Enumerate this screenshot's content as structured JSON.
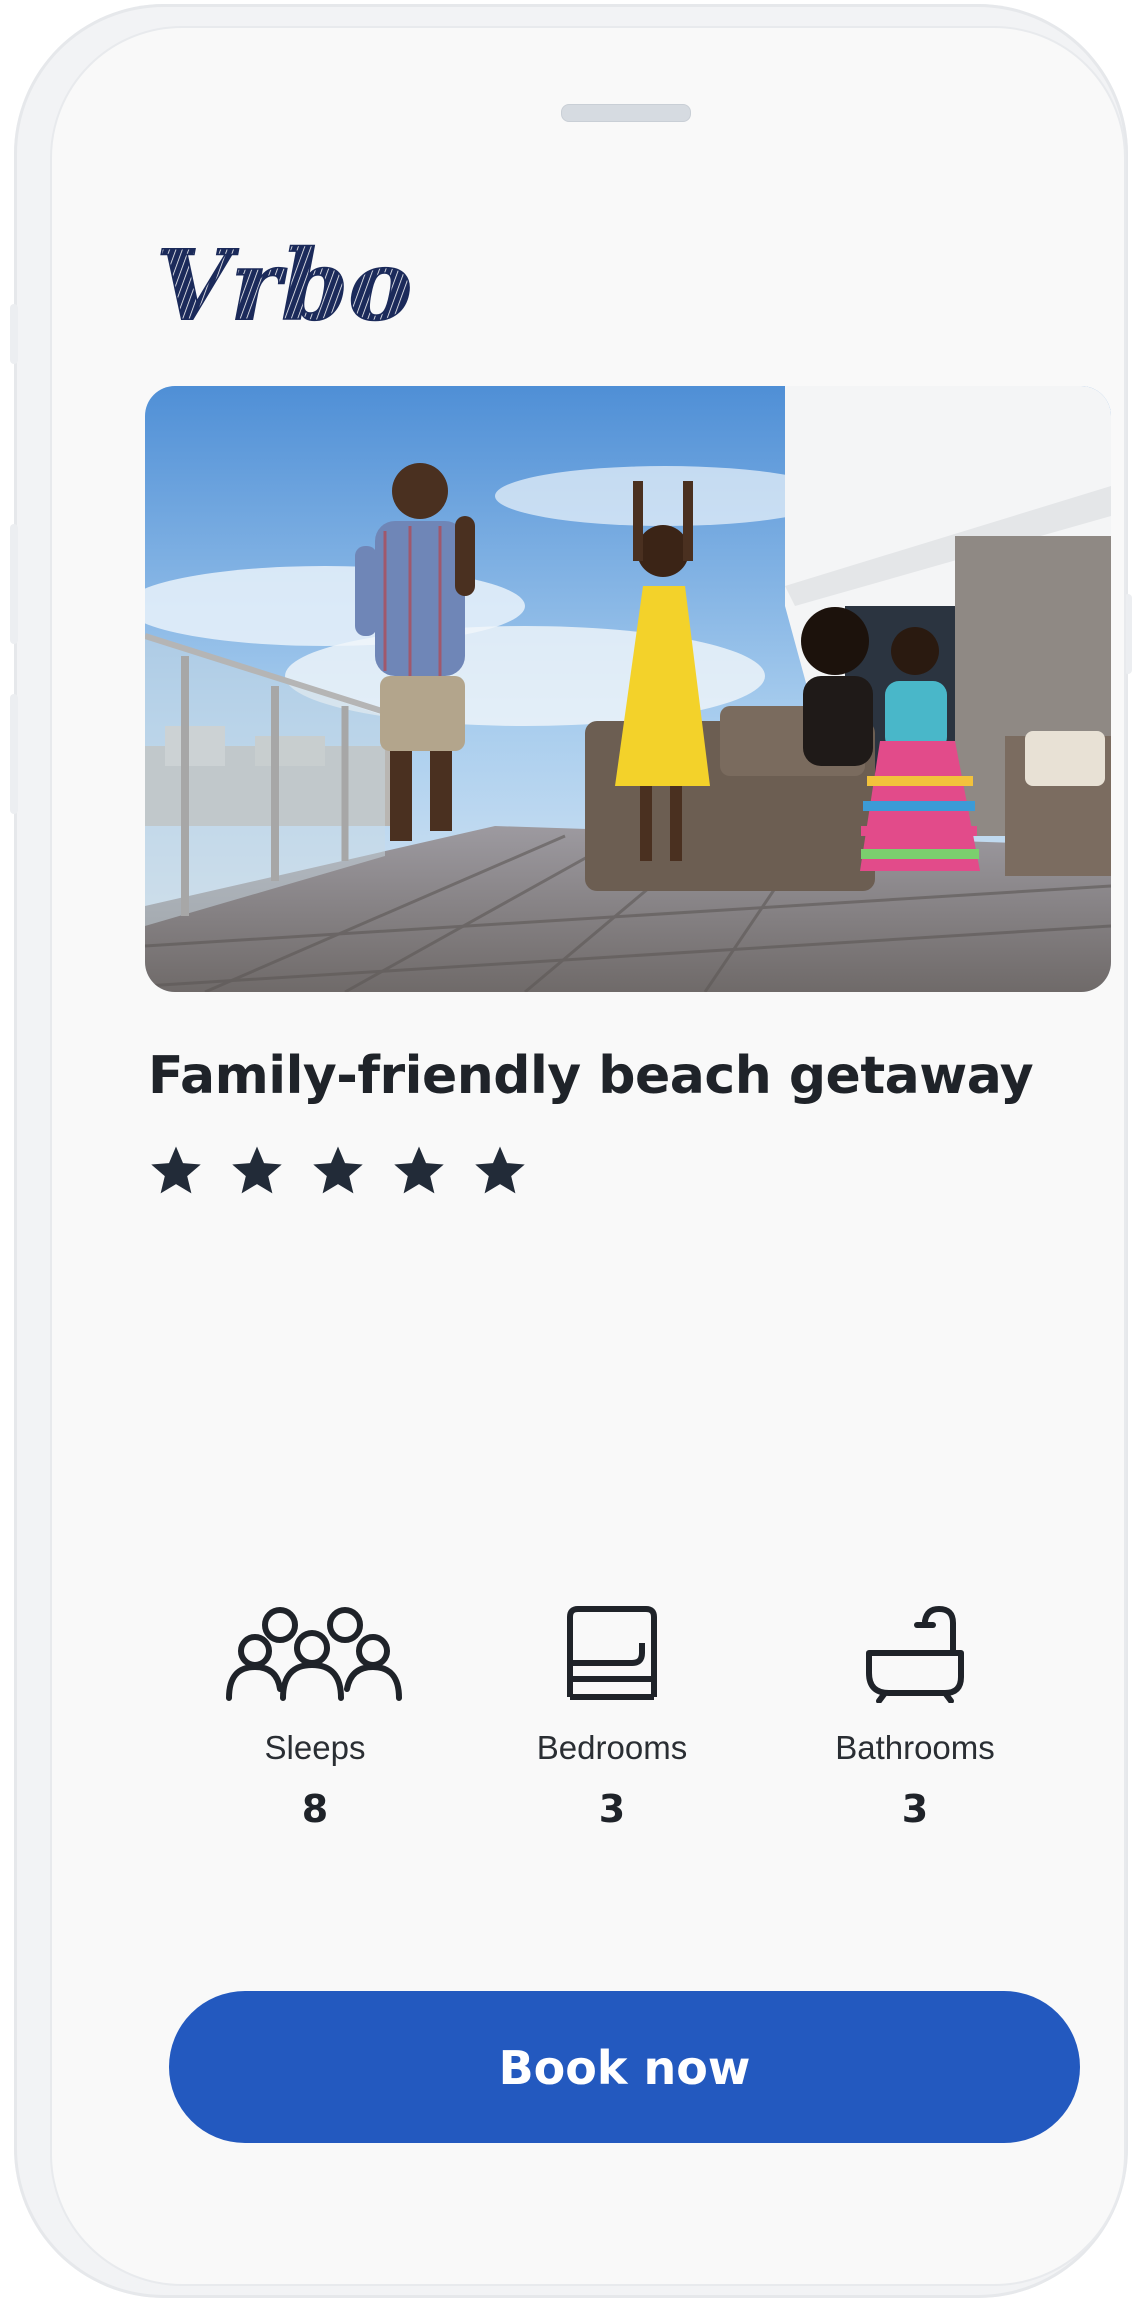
{
  "brand": {
    "logo_text": "Vrbo",
    "logo_color": "#1b2a5a"
  },
  "listing": {
    "title": "Family-friendly beach getaway",
    "rating_stars": 5,
    "rating_color": "#222b38",
    "photo_alt": "Family dancing on a sunny beach house deck"
  },
  "amenities": [
    {
      "icon": "people-icon",
      "label": "Sleeps",
      "value": "8"
    },
    {
      "icon": "bed-icon",
      "label": "Bedrooms",
      "value": "3"
    },
    {
      "icon": "bathtub-icon",
      "label": "Bathrooms",
      "value": "3"
    }
  ],
  "cta": {
    "label": "Book now",
    "color": "#2359bf"
  }
}
